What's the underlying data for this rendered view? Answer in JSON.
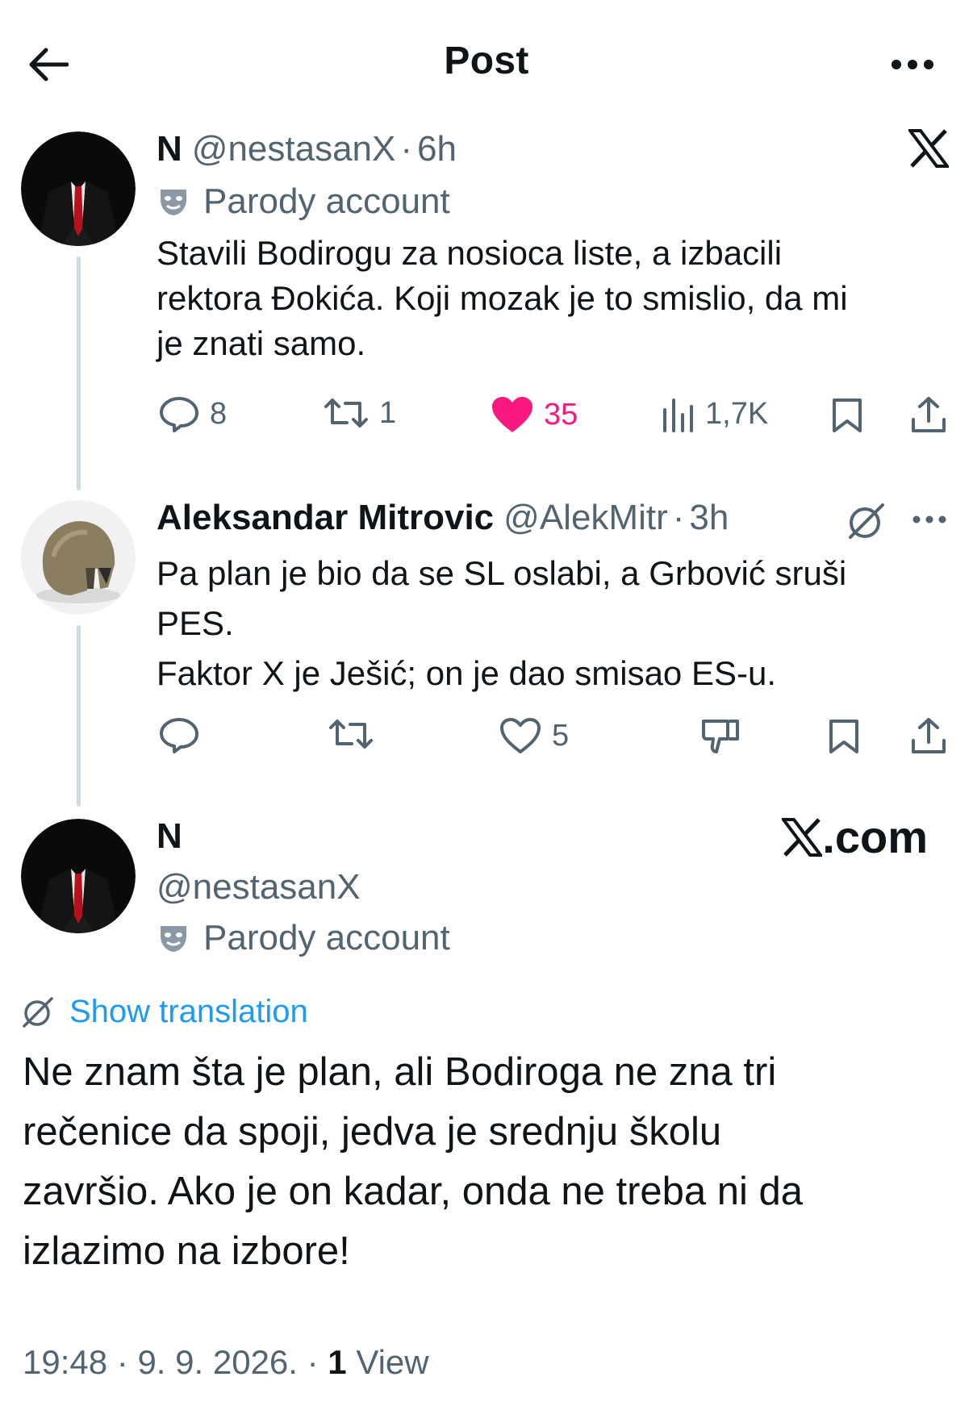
{
  "header": {
    "title": "Post"
  },
  "parent_tweet": {
    "display_name": "N",
    "handle": "@nestasanX",
    "separator": "·",
    "time": "6h",
    "label": "Parody account",
    "text_lines": [
      "Stavili Bodirogu za nosioca liste, a izbacili",
      "rektora Đokića. Koji mozak je to smislio, da mi",
      "je znati samo."
    ],
    "replies": "8",
    "reposts": "1",
    "likes": "35",
    "views": "1,7K"
  },
  "reply_tweet": {
    "display_name": "Aleksandar Mitrovic",
    "handle": "@AlekMitr",
    "separator": "·",
    "time": "3h",
    "text_lines": [
      "Pa plan je bio da se SL oslabi, a Grbović sruši",
      "PES.",
      "Faktor X je Ješić; on je dao smisao ES-u."
    ],
    "likes": "5"
  },
  "main_tweet": {
    "display_name": "N",
    "handle": "@nestasanX",
    "label": "Parody account",
    "watermark": ".com",
    "translate_label": "Show translation",
    "text_lines": [
      "Ne znam šta je plan, ali Bodiroga ne zna tri",
      "rečenice da spoji, jedva je srednju školu",
      "završio. Ako je on kadar, onda ne treba ni da",
      "izlazimo na izbore!"
    ],
    "time": "19:48",
    "separator": "·",
    "date": "9. 9. 2026.",
    "views_count": "1",
    "views_label": "View"
  },
  "colors": {
    "text": "#0f1419",
    "secondary": "#536471",
    "like": "#f91880",
    "link": "#1d9bf0",
    "thread_line": "#cfd9de"
  },
  "icons": [
    "back-arrow-icon",
    "more-icon",
    "x-logo-icon",
    "parody-mask-icon",
    "reply-icon",
    "repost-icon",
    "heart-icon",
    "views-icon",
    "bookmark-icon",
    "share-icon",
    "grok-icon",
    "downvote-icon",
    "translate-icon"
  ]
}
